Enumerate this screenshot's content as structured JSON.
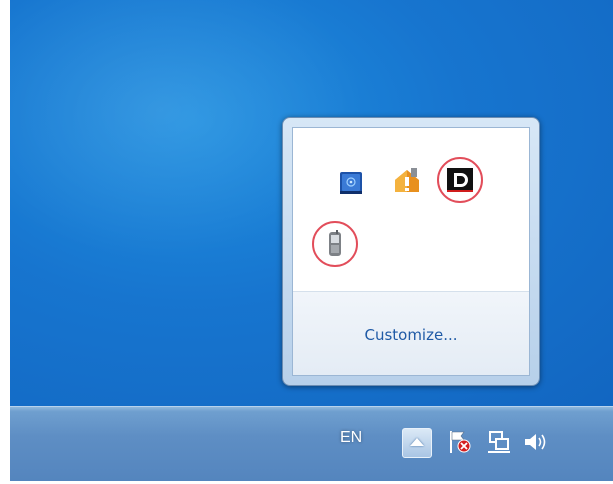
{
  "taskbar": {
    "language": "EN",
    "show_hidden_icons": "show-hidden-icons",
    "tray_icons": [
      {
        "name": "action-center-flag-icon"
      },
      {
        "name": "network-icon"
      },
      {
        "name": "volume-icon"
      }
    ]
  },
  "overflow_popup": {
    "icons": [
      {
        "name": "blue-book-icon"
      },
      {
        "name": "orange-warning-icon"
      },
      {
        "name": "d-logo-icon"
      },
      {
        "name": "phone-device-icon"
      }
    ],
    "customize_label": "Customize..."
  },
  "colors": {
    "desktop": "#1775cf",
    "highlight_ring": "#e24d5a",
    "link": "#1f5aa6"
  }
}
